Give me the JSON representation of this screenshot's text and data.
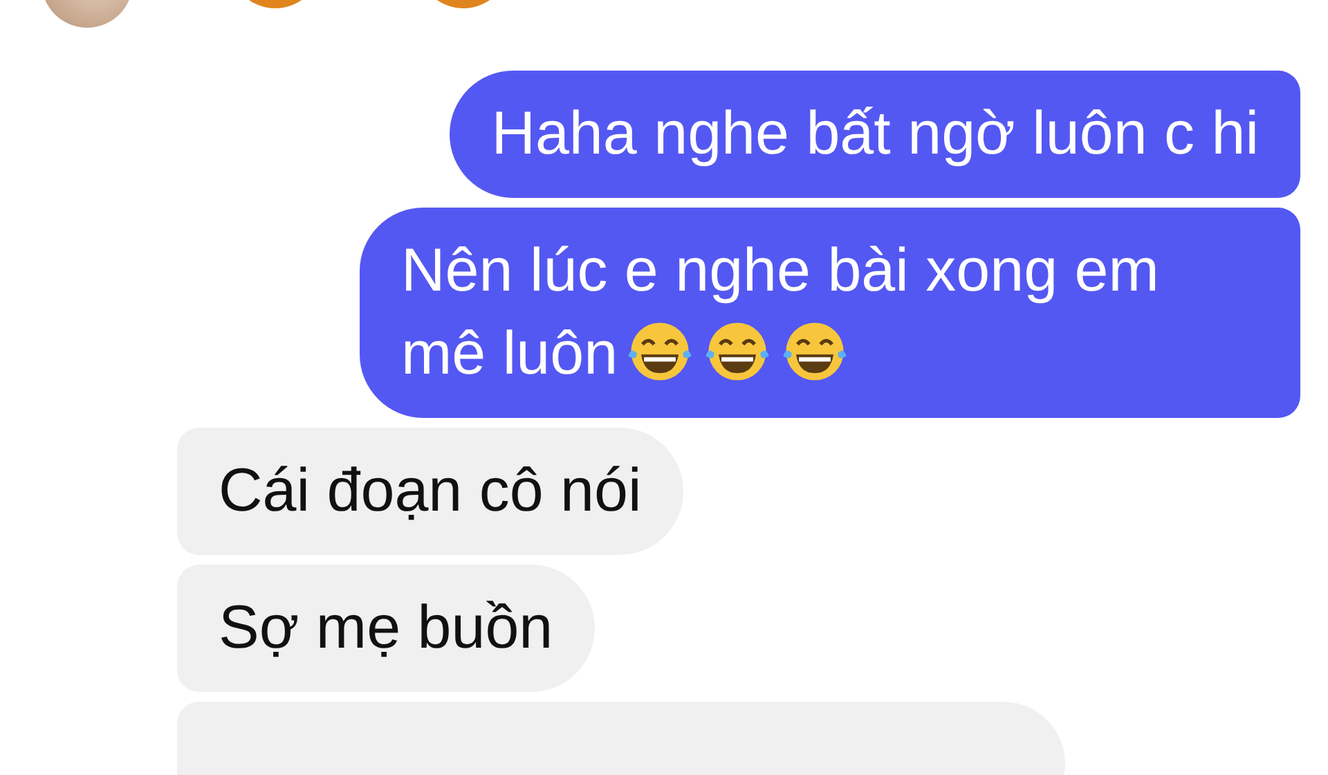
{
  "header": {
    "reactions": [
      {
        "kind": "emoji"
      },
      {
        "kind": "emoji"
      }
    ]
  },
  "messages": [
    {
      "kind": "sent",
      "text": "Haha nghe bất ngờ luôn c hi"
    },
    {
      "kind": "sent",
      "text": "Nên lúc e nghe bài xong em mê luôn",
      "emojis": [
        {
          "kind": "tears-of-joy"
        },
        {
          "kind": "tears-of-joy"
        },
        {
          "kind": "tears-of-joy"
        }
      ]
    },
    {
      "kind": "received",
      "text": "Cái đoạn cô nói"
    },
    {
      "kind": "received",
      "text": "Sợ mẹ buồn"
    },
    {
      "kind": "received-cut-off"
    }
  ]
}
